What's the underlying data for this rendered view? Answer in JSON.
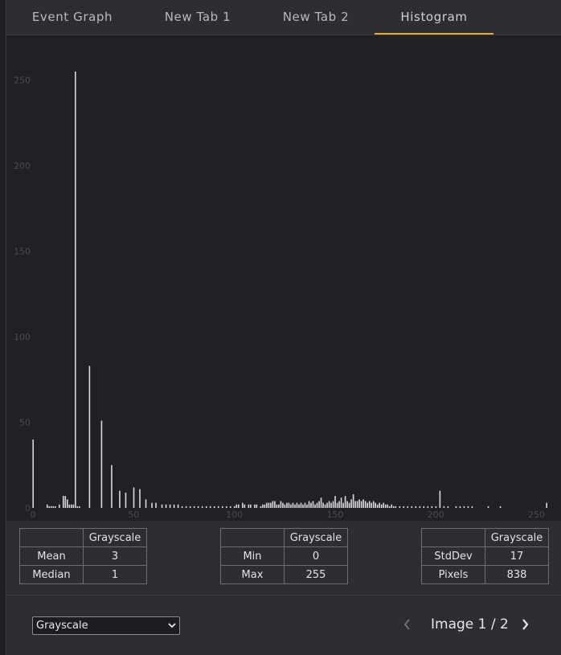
{
  "tabs": [
    {
      "label": "Event Graph",
      "active": false
    },
    {
      "label": "New Tab 1",
      "active": false
    },
    {
      "label": "New Tab 2",
      "active": false
    },
    {
      "label": "Histogram",
      "active": true
    }
  ],
  "colors": {
    "accent": "#e9a823",
    "bars": "#d9d9dc",
    "plot_background": "#202125",
    "tick_labels": "#4a4b50"
  },
  "chart_data": {
    "type": "bar",
    "title": "",
    "xlabel": "",
    "ylabel": "",
    "xlim": [
      0,
      256
    ],
    "ylim": [
      0,
      265
    ],
    "x_ticks": [
      0,
      50,
      100,
      150,
      200,
      250
    ],
    "y_ticks": [
      0,
      50,
      100,
      150,
      200,
      250
    ],
    "grid": false,
    "bins": [
      {
        "x": 0,
        "y": 40
      },
      {
        "x": 7,
        "y": 2
      },
      {
        "x": 8,
        "y": 1
      },
      {
        "x": 9,
        "y": 1
      },
      {
        "x": 10,
        "y": 1
      },
      {
        "x": 11,
        "y": 1
      },
      {
        "x": 13,
        "y": 2
      },
      {
        "x": 15,
        "y": 7
      },
      {
        "x": 16,
        "y": 7
      },
      {
        "x": 17,
        "y": 5
      },
      {
        "x": 18,
        "y": 2
      },
      {
        "x": 19,
        "y": 2
      },
      {
        "x": 20,
        "y": 2
      },
      {
        "x": 21,
        "y": 255
      },
      {
        "x": 22,
        "y": 1
      },
      {
        "x": 23,
        "y": 1
      },
      {
        "x": 28,
        "y": 83
      },
      {
        "x": 34,
        "y": 51
      },
      {
        "x": 39,
        "y": 25
      },
      {
        "x": 43,
        "y": 10
      },
      {
        "x": 46,
        "y": 9
      },
      {
        "x": 50,
        "y": 12
      },
      {
        "x": 53,
        "y": 11
      },
      {
        "x": 56,
        "y": 5
      },
      {
        "x": 59,
        "y": 3
      },
      {
        "x": 61,
        "y": 3
      },
      {
        "x": 64,
        "y": 2
      },
      {
        "x": 66,
        "y": 2
      },
      {
        "x": 68,
        "y": 2
      },
      {
        "x": 70,
        "y": 2
      },
      {
        "x": 72,
        "y": 2
      },
      {
        "x": 74,
        "y": 1
      },
      {
        "x": 76,
        "y": 1
      },
      {
        "x": 78,
        "y": 1
      },
      {
        "x": 80,
        "y": 1
      },
      {
        "x": 82,
        "y": 1
      },
      {
        "x": 84,
        "y": 1
      },
      {
        "x": 86,
        "y": 1
      },
      {
        "x": 88,
        "y": 1
      },
      {
        "x": 90,
        "y": 1
      },
      {
        "x": 92,
        "y": 1
      },
      {
        "x": 94,
        "y": 1
      },
      {
        "x": 96,
        "y": 1
      },
      {
        "x": 98,
        "y": 1
      },
      {
        "x": 100,
        "y": 1
      },
      {
        "x": 101,
        "y": 2
      },
      {
        "x": 102,
        "y": 2
      },
      {
        "x": 104,
        "y": 3
      },
      {
        "x": 105,
        "y": 2
      },
      {
        "x": 107,
        "y": 2
      },
      {
        "x": 108,
        "y": 2
      },
      {
        "x": 110,
        "y": 2
      },
      {
        "x": 111,
        "y": 2
      },
      {
        "x": 113,
        "y": 1
      },
      {
        "x": 114,
        "y": 2
      },
      {
        "x": 115,
        "y": 2
      },
      {
        "x": 116,
        "y": 3
      },
      {
        "x": 117,
        "y": 3
      },
      {
        "x": 118,
        "y": 3
      },
      {
        "x": 119,
        "y": 4
      },
      {
        "x": 120,
        "y": 4
      },
      {
        "x": 121,
        "y": 2
      },
      {
        "x": 122,
        "y": 2
      },
      {
        "x": 123,
        "y": 4
      },
      {
        "x": 124,
        "y": 3
      },
      {
        "x": 125,
        "y": 2
      },
      {
        "x": 126,
        "y": 3
      },
      {
        "x": 127,
        "y": 3
      },
      {
        "x": 128,
        "y": 2
      },
      {
        "x": 129,
        "y": 3
      },
      {
        "x": 130,
        "y": 2
      },
      {
        "x": 131,
        "y": 3
      },
      {
        "x": 132,
        "y": 2
      },
      {
        "x": 133,
        "y": 3
      },
      {
        "x": 134,
        "y": 2
      },
      {
        "x": 135,
        "y": 3
      },
      {
        "x": 136,
        "y": 2
      },
      {
        "x": 137,
        "y": 4
      },
      {
        "x": 138,
        "y": 3
      },
      {
        "x": 139,
        "y": 4
      },
      {
        "x": 140,
        "y": 2
      },
      {
        "x": 141,
        "y": 3
      },
      {
        "x": 142,
        "y": 4
      },
      {
        "x": 143,
        "y": 6
      },
      {
        "x": 144,
        "y": 3
      },
      {
        "x": 145,
        "y": 2
      },
      {
        "x": 146,
        "y": 3
      },
      {
        "x": 147,
        "y": 4
      },
      {
        "x": 148,
        "y": 3
      },
      {
        "x": 149,
        "y": 4
      },
      {
        "x": 150,
        "y": 7
      },
      {
        "x": 151,
        "y": 3
      },
      {
        "x": 152,
        "y": 4
      },
      {
        "x": 153,
        "y": 6
      },
      {
        "x": 154,
        "y": 3
      },
      {
        "x": 155,
        "y": 7
      },
      {
        "x": 156,
        "y": 4
      },
      {
        "x": 157,
        "y": 3
      },
      {
        "x": 158,
        "y": 5
      },
      {
        "x": 159,
        "y": 8
      },
      {
        "x": 160,
        "y": 4
      },
      {
        "x": 161,
        "y": 4
      },
      {
        "x": 162,
        "y": 5
      },
      {
        "x": 163,
        "y": 4
      },
      {
        "x": 164,
        "y": 5
      },
      {
        "x": 165,
        "y": 4
      },
      {
        "x": 166,
        "y": 3
      },
      {
        "x": 167,
        "y": 4
      },
      {
        "x": 168,
        "y": 3
      },
      {
        "x": 169,
        "y": 4
      },
      {
        "x": 170,
        "y": 3
      },
      {
        "x": 171,
        "y": 2
      },
      {
        "x": 172,
        "y": 3
      },
      {
        "x": 173,
        "y": 2
      },
      {
        "x": 174,
        "y": 3
      },
      {
        "x": 175,
        "y": 2
      },
      {
        "x": 176,
        "y": 2
      },
      {
        "x": 177,
        "y": 1
      },
      {
        "x": 178,
        "y": 2
      },
      {
        "x": 179,
        "y": 1
      },
      {
        "x": 180,
        "y": 1
      },
      {
        "x": 182,
        "y": 1
      },
      {
        "x": 184,
        "y": 1
      },
      {
        "x": 186,
        "y": 1
      },
      {
        "x": 188,
        "y": 1
      },
      {
        "x": 190,
        "y": 1
      },
      {
        "x": 192,
        "y": 1
      },
      {
        "x": 194,
        "y": 1
      },
      {
        "x": 196,
        "y": 1
      },
      {
        "x": 198,
        "y": 1
      },
      {
        "x": 200,
        "y": 1
      },
      {
        "x": 202,
        "y": 10
      },
      {
        "x": 204,
        "y": 1
      },
      {
        "x": 206,
        "y": 1
      },
      {
        "x": 210,
        "y": 1
      },
      {
        "x": 212,
        "y": 1
      },
      {
        "x": 214,
        "y": 1
      },
      {
        "x": 216,
        "y": 1
      },
      {
        "x": 218,
        "y": 1
      },
      {
        "x": 226,
        "y": 1
      },
      {
        "x": 232,
        "y": 1
      },
      {
        "x": 255,
        "y": 3
      }
    ]
  },
  "stats": [
    {
      "header": "Grayscale",
      "rows": [
        {
          "label": "Mean",
          "value": "3"
        },
        {
          "label": "Median",
          "value": "1"
        }
      ]
    },
    {
      "header": "Grayscale",
      "rows": [
        {
          "label": "Min",
          "value": "0"
        },
        {
          "label": "Max",
          "value": "255"
        }
      ]
    },
    {
      "header": "Grayscale",
      "rows": [
        {
          "label": "StdDev",
          "value": "17"
        },
        {
          "label": "Pixels",
          "value": "838"
        }
      ]
    }
  ],
  "channel_select": {
    "value": "Grayscale"
  },
  "pager": {
    "label": "Image 1 / 2"
  }
}
